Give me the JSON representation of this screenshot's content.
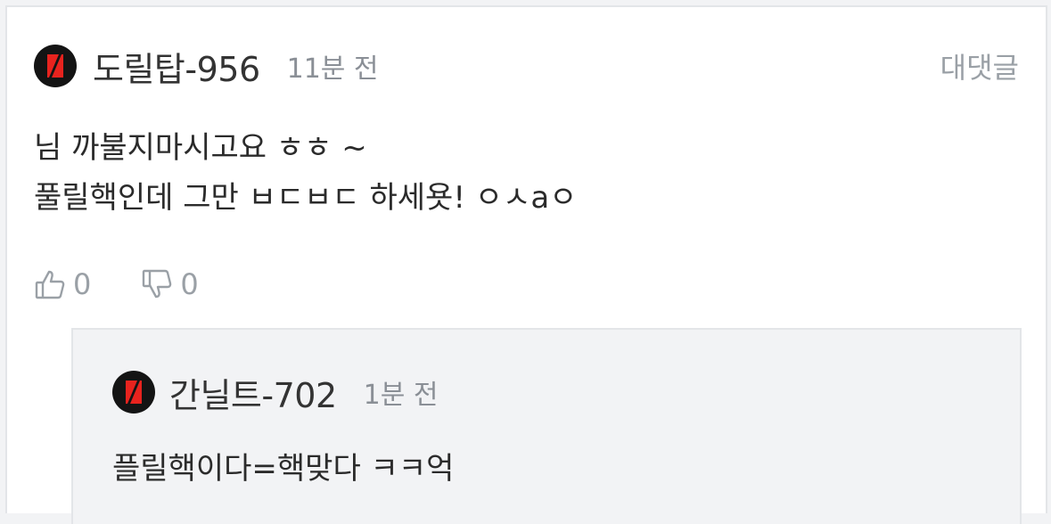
{
  "comment": {
    "username": "도릴탑-956",
    "timestamp": "11분 전",
    "reply_label": "대댓글",
    "body_lines": [
      "님 까불지마시고요 ㅎㅎ ~",
      "풀릴핵인데 그만 ㅂㄷㅂㄷ 하세욧! ㅇㅅaㅇ"
    ],
    "likes": "0",
    "dislikes": "0"
  },
  "reply": {
    "username": "간닐트-702",
    "timestamp": "1분 전",
    "body": "플릴핵이다=핵맞다 ㅋㅋ억"
  },
  "colors": {
    "avatar_bg": "#141414",
    "avatar_mark": "#e8231e",
    "muted_text": "#9aa0a6",
    "reply_bg": "#f2f3f5"
  },
  "icons": {
    "avatar": "lightning-bolt-logo-icon",
    "like": "thumbs-up-icon",
    "dislike": "thumbs-down-icon"
  }
}
